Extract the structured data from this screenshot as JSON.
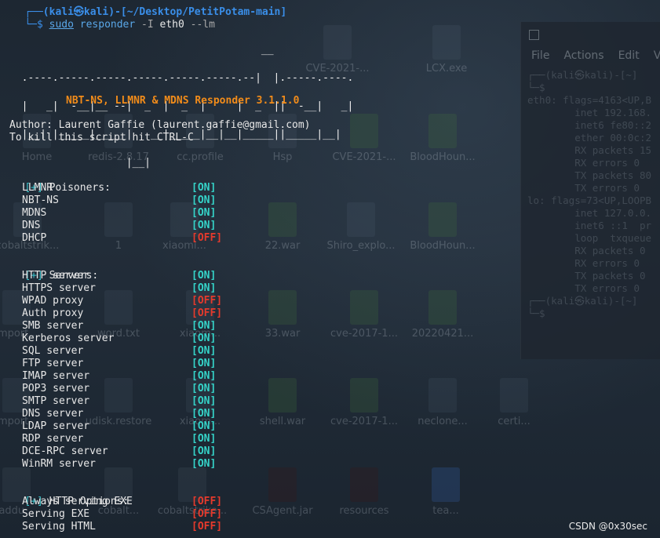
{
  "prompt": {
    "top_fragment": "(kali㉿kali)-[~/Desktop/PetitPotam-main]",
    "dollar": "└─$",
    "command": "sudo",
    "command_rest": " responder ",
    "flag_I": "-I",
    "iface": " eth0 ",
    "flag_lm": "--lm"
  },
  "banner": {
    "ascii_line1": "                                         __",
    "ascii_line2": "  .----.-----.-----.-----.-----.-----.--|  |.-----.----.",
    "ascii_line3": "  |   _|  -__|__ --|  _  |  _  |     |  _  ||  -__|   _|",
    "ascii_line4": "  |__| |_____|_____|   __|_____|__|__|_____||_____|__|",
    "ascii_line5": "                   |__|",
    "title": "NBT-NS, LLMNR & MDNS Responder 3.1.1.0",
    "author": "Author: Laurent Gaffie (laurent.gaffie@gmail.com)",
    "kill_hint": "To kill this script hit CTRL-C"
  },
  "sections": {
    "poisoners": {
      "marker": "[+]",
      "title": " Poisoners:",
      "items": [
        {
          "label": "LLMNR",
          "status": "[ON]"
        },
        {
          "label": "NBT-NS",
          "status": "[ON]"
        },
        {
          "label": "MDNS",
          "status": "[ON]"
        },
        {
          "label": "DNS",
          "status": "[ON]"
        },
        {
          "label": "DHCP",
          "status": "[OFF]"
        }
      ]
    },
    "servers": {
      "marker": "[+]",
      "title": " Servers:",
      "items": [
        {
          "label": "HTTP server",
          "status": "[ON]"
        },
        {
          "label": "HTTPS server",
          "status": "[ON]"
        },
        {
          "label": "WPAD proxy",
          "status": "[OFF]"
        },
        {
          "label": "Auth proxy",
          "status": "[OFF]"
        },
        {
          "label": "SMB server",
          "status": "[ON]"
        },
        {
          "label": "Kerberos server",
          "status": "[ON]"
        },
        {
          "label": "SQL server",
          "status": "[ON]"
        },
        {
          "label": "FTP server",
          "status": "[ON]"
        },
        {
          "label": "IMAP server",
          "status": "[ON]"
        },
        {
          "label": "POP3 server",
          "status": "[ON]"
        },
        {
          "label": "SMTP server",
          "status": "[ON]"
        },
        {
          "label": "DNS server",
          "status": "[ON]"
        },
        {
          "label": "LDAP server",
          "status": "[ON]"
        },
        {
          "label": "RDP server",
          "status": "[ON]"
        },
        {
          "label": "DCE-RPC server",
          "status": "[ON]"
        },
        {
          "label": "WinRM server",
          "status": "[ON]"
        }
      ]
    },
    "http_options": {
      "marker": "[+]",
      "title": " HTTP Options:",
      "items": [
        {
          "label": "Always serving EXE",
          "status": "[OFF]"
        },
        {
          "label": "Serving EXE",
          "status": "[OFF]"
        },
        {
          "label": "Serving HTML",
          "status": "[OFF]"
        }
      ]
    }
  },
  "side_window": {
    "menu": [
      "File",
      "Actions",
      "Edit",
      "View"
    ],
    "lines": [
      "┌──(kali㉿kali)-[~]",
      "└─$ ",
      "eth0: flags=4163<UP,B",
      "        inet 192.168.",
      "        inet6 fe80::2",
      "        ether 00:0c:2",
      "        RX packets 15",
      "        RX errors 0",
      "        TX packets 80",
      "        TX errors 0",
      "",
      "lo: flags=73<UP,LOOPB",
      "        inet 127.0.0.",
      "        inet6 ::1  pr",
      "        loop  txqueue",
      "        RX packets 0",
      "        RX errors 0",
      "        TX packets 0",
      "        TX errors 0",
      "",
      "",
      "┌──(kali㉿kali)-[~]",
      "└─$ "
    ]
  },
  "desktop": {
    "icons": [
      "CVE-2021-...",
      "LCX.exe",
      "Home",
      "redis-2.8.17",
      "cc.profile",
      "Hsp",
      "CVE-2021-...",
      "BloodHoun...",
      "cobaltstrik...",
      "1",
      "xiaomi...",
      "22.war",
      "Shiro_explo...",
      "BloodHoun...",
      "import...",
      "word.txt",
      "xiaom...",
      "33.war",
      "cve-2017-1...",
      "20220421...",
      "import...",
      "udisk.restore",
      "xiaom...",
      "shell.war",
      "cve-2017-1...",
      "neclone...",
      "certi...",
      "addu...",
      "cobalt...",
      "cobaltstrike...",
      "CSAgent.jar",
      "resources",
      "tea..."
    ]
  },
  "watermark": "CSDN @0x30sec"
}
